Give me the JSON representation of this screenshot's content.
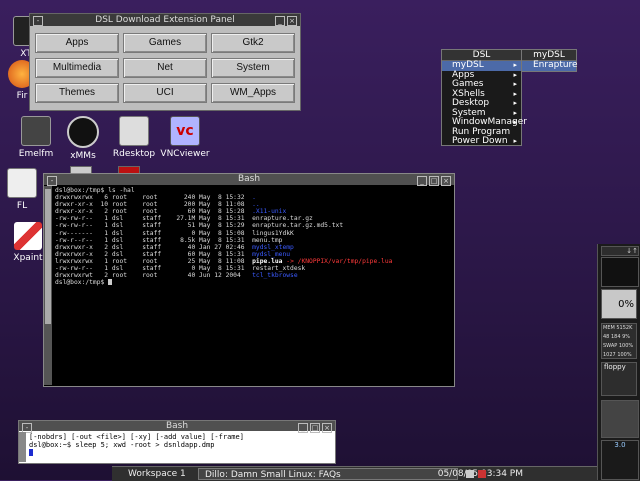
{
  "desktop_icons": [
    {
      "label": "XTe",
      "name": "xterm"
    },
    {
      "label": "Fir",
      "name": "firefox"
    },
    {
      "label": "Emelfm",
      "name": "emelfm"
    },
    {
      "label": "xMMs",
      "name": "xmms"
    },
    {
      "label": "Rdesktop",
      "name": "rdesktop"
    },
    {
      "label": "VNCviewer",
      "name": "vncviewer"
    },
    {
      "label": "FL",
      "name": "fl"
    },
    {
      "label": "Xpaint",
      "name": "xpaint"
    }
  ],
  "panel": {
    "title": "DSL Download Extension Panel",
    "buttons": [
      "Apps",
      "Games",
      "Gtk2",
      "Multimedia",
      "Net",
      "System",
      "Themes",
      "UCI",
      "WM_Apps"
    ]
  },
  "menu": {
    "header": "DSL",
    "items": [
      "myDSL",
      "Apps",
      "Games",
      "XShells",
      "Desktop",
      "System",
      "WindowManager",
      "Run Program",
      "Power Down"
    ],
    "submenu_header": "myDSL",
    "submenu_items": [
      "Enrapture"
    ]
  },
  "terminal": {
    "title": "Bash",
    "prompt": "dsl@box:/tmp$ ls -hal",
    "rows": [
      {
        "perm": "drwxrwxrwx",
        "n": "6",
        "u": "root",
        "g": "root",
        "size": "240",
        "mon": "May",
        "day": "8",
        "time": "15:32",
        "name": ".",
        "color": "#3b5bff"
      },
      {
        "perm": "drwxr-xr-x",
        "n": "10",
        "u": "root",
        "g": "root",
        "size": "200",
        "mon": "May",
        "day": "8",
        "time": "11:08",
        "name": "..",
        "color": "#3b5bff"
      },
      {
        "perm": "drwxr-xr-x",
        "n": "2",
        "u": "root",
        "g": "root",
        "size": "60",
        "mon": "May",
        "day": "8",
        "time": "15:28",
        "name": ".X11-unix",
        "color": "#3b5bff"
      },
      {
        "perm": "-rw-rw-r--",
        "n": "1",
        "u": "dsl",
        "g": "staff",
        "size": "27.1M",
        "mon": "May",
        "day": "8",
        "time": "15:31",
        "name": "enrapture.tar.gz",
        "color": "#dcdcdc"
      },
      {
        "perm": "-rw-rw-r--",
        "n": "1",
        "u": "dsl",
        "g": "staff",
        "size": "51",
        "mon": "May",
        "day": "8",
        "time": "15:29",
        "name": "enrapture.tar.gz.md5.txt",
        "color": "#dcdcdc"
      },
      {
        "perm": "-rw-------",
        "n": "1",
        "u": "dsl",
        "g": "staff",
        "size": "0",
        "mon": "May",
        "day": "8",
        "time": "15:08",
        "name": "lingus1YdkK",
        "color": "#dcdcdc"
      },
      {
        "perm": "-rw-r--r--",
        "n": "1",
        "u": "dsl",
        "g": "staff",
        "size": "8.5k",
        "mon": "May",
        "day": "8",
        "time": "15:31",
        "name": "menu.tmp",
        "color": "#dcdcdc"
      },
      {
        "perm": "drwxrwxr-x",
        "n": "2",
        "u": "dsl",
        "g": "staff",
        "size": "40",
        "mon": "Jan",
        "day": "27",
        "time": "02:46",
        "name": "mydsl_xtemp",
        "color": "#3b5bff"
      },
      {
        "perm": "drwxrwxr-x",
        "n": "2",
        "u": "dsl",
        "g": "staff",
        "size": "60",
        "mon": "May",
        "day": "8",
        "time": "15:31",
        "name": "mydsl_menu",
        "color": "#3b5bff"
      },
      {
        "perm": "lrwxrwxrwx",
        "n": "1",
        "u": "root",
        "g": "root",
        "size": "25",
        "mon": "May",
        "day": "8",
        "time": "11:08",
        "name": "pipe.lua",
        "link": " -> /KNOPPIX/var/tmp/pipe.lua",
        "color": "#ffffff"
      },
      {
        "perm": "-rw-rw-r--",
        "n": "1",
        "u": "dsl",
        "g": "staff",
        "size": "0",
        "mon": "May",
        "day": "8",
        "time": "15:31",
        "name": "restart_xtdesk",
        "color": "#dcdcdc"
      },
      {
        "perm": "drwxrwxrwt",
        "n": "2",
        "u": "root",
        "g": "root",
        "size": "40",
        "mon": "Jun",
        "day": "12",
        "time": "2004",
        "name": "tcl_tkbrowse",
        "color": "#3b5bff"
      }
    ],
    "end_prompt": "dsl@box:/tmp$ "
  },
  "terminal2": {
    "title": "Bash",
    "lines": [
      "[-nobdrs] [-out <file>] [-xy] [-add value] [-frame]",
      "dsl@box:~$ sleep 5; xwd -root > dsnldapp.dmp"
    ]
  },
  "taskbar": {
    "workspace": "Workspace 1",
    "window": "Dillo: Damn Small Linux: FAQs",
    "datetime": "05/08/05 03:34 PM"
  },
  "dock": {
    "cpu_label": "0%",
    "mem_lines": [
      "MEM 5152K",
      "48 184 9%",
      "SWAP 100%",
      "1027 100%"
    ],
    "floppy_label": "floppy",
    "version_label": "3.0"
  },
  "colors": {
    "dir": "#3b5bff",
    "link_target": "#ff3a3a",
    "link": "#ffffff"
  }
}
